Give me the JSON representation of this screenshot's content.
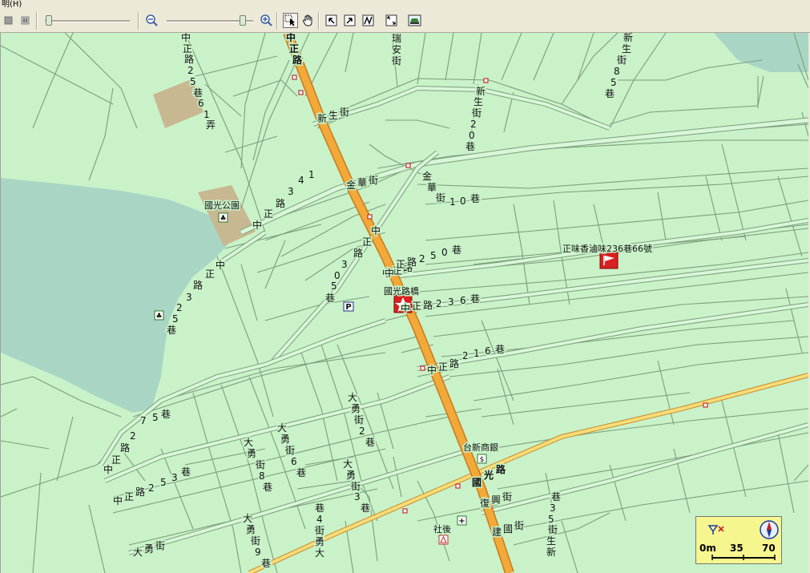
{
  "menu": {
    "help_label": "明(H)"
  },
  "map": {
    "colors": {
      "background": "#c9f2c9",
      "water": "#a9d6c4",
      "park": "#c8b891",
      "road": "#7c9e7c",
      "main_road": "#f2a93a"
    },
    "roads": {
      "zhongzheng": [
        "中",
        "正",
        "路"
      ],
      "zhongzheng_lower": [
        "中",
        "正",
        "路"
      ],
      "guoguang": [
        "國",
        "光",
        "路"
      ],
      "jinhua_h": "金華街",
      "jinhua_v": [
        "金",
        "華",
        "街",
        "1",
        "0",
        "巷"
      ],
      "xinsheng": "新生街",
      "ruian": [
        "瑞",
        "安",
        "街"
      ],
      "fuxing": "復興街",
      "jianguo": "建國街",
      "dayong": "大勇街"
    },
    "alleys": {
      "zz250": "中正路250巷",
      "zz236": "中正路236巷",
      "zz216": "中正路216巷",
      "zz253": "中正路253巷",
      "zz341": [
        "1",
        "4",
        "3",
        "路",
        "正",
        "中"
      ],
      "zz305": [
        "中",
        "正",
        "路",
        "3",
        "0",
        "5",
        "巷"
      ],
      "zz325": [
        "中",
        "正",
        "路",
        "3",
        "2",
        "5",
        "巷"
      ],
      "zz275": [
        "中",
        "正",
        "路",
        "2",
        "7",
        "5",
        "巷"
      ],
      "zz2561": [
        "中",
        "正",
        "路",
        "2",
        "5",
        "巷",
        "6",
        "1",
        "弄"
      ],
      "xs85": [
        "新",
        "生",
        "街",
        "8",
        "5",
        "巷"
      ],
      "xs20": [
        "新",
        "生",
        "街",
        "2",
        "0",
        "巷"
      ],
      "xs35": [
        "巷",
        "3",
        "5",
        "街",
        "生",
        "新"
      ],
      "dy2": [
        "大",
        "勇",
        "街",
        "2",
        "巷"
      ],
      "dy3": [
        "大",
        "勇",
        "街",
        "3",
        "巷"
      ],
      "dy6": [
        "大",
        "勇",
        "街",
        "6",
        "巷"
      ],
      "dy8": [
        "大",
        "勇",
        "街",
        "8",
        "巷"
      ],
      "dy9": [
        "大",
        "勇",
        "街",
        "9",
        "巷"
      ],
      "dy4": [
        "巷",
        "4",
        "街",
        "勇",
        "大"
      ]
    },
    "places": {
      "park": "國光公園",
      "bridge": "國光路橋",
      "destination": "正味香滷味236巷66號",
      "bank": "台新商銀",
      "community": "社後"
    }
  },
  "scale": {
    "labels": [
      "0m",
      "35",
      "70"
    ]
  }
}
